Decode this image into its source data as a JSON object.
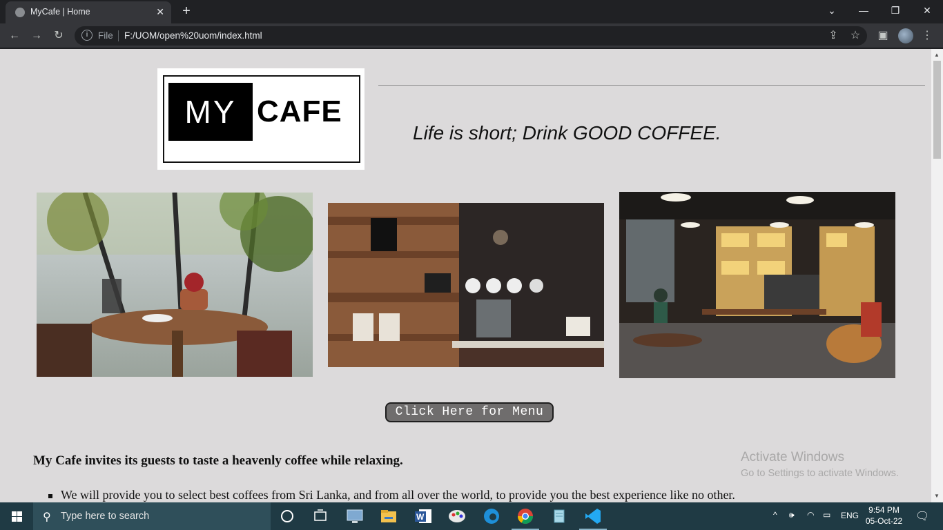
{
  "browser": {
    "tab_title": "MyCafe | Home",
    "omnibox_scheme": "File",
    "omnibox_url": "F:/UOM/open%20uom/index.html"
  },
  "page": {
    "logo": {
      "my": "MY",
      "cafe": "CAFE"
    },
    "tagline": "Life is short; Drink GOOD COFFEE.",
    "menu_button": "Click Here for Menu",
    "intro": "My Cafe invites its guests to taste a heavenly coffee while relaxing.",
    "bullets": [
      "We will provide you to select best coffees from Sri Lanka, and from all over the world, to provide you the best experience like no other."
    ]
  },
  "watermark": {
    "line1": "Activate Windows",
    "line2": "Go to Settings to activate Windows."
  },
  "taskbar": {
    "search_placeholder": "Type here to search",
    "language": "ENG",
    "time": "9:54 PM",
    "date": "05-Oct-22",
    "pinned_apps": [
      "cortana-icon",
      "task-view-icon",
      "remote-desktop-icon",
      "file-explorer-icon",
      "word-icon",
      "paint-icon",
      "edge-icon",
      "chrome-icon",
      "notepad-icon",
      "vscode-icon"
    ]
  },
  "colors": {
    "page_background": "#dcdadb",
    "button_background": "#6f6d6d",
    "taskbar": "#1f3a44"
  }
}
